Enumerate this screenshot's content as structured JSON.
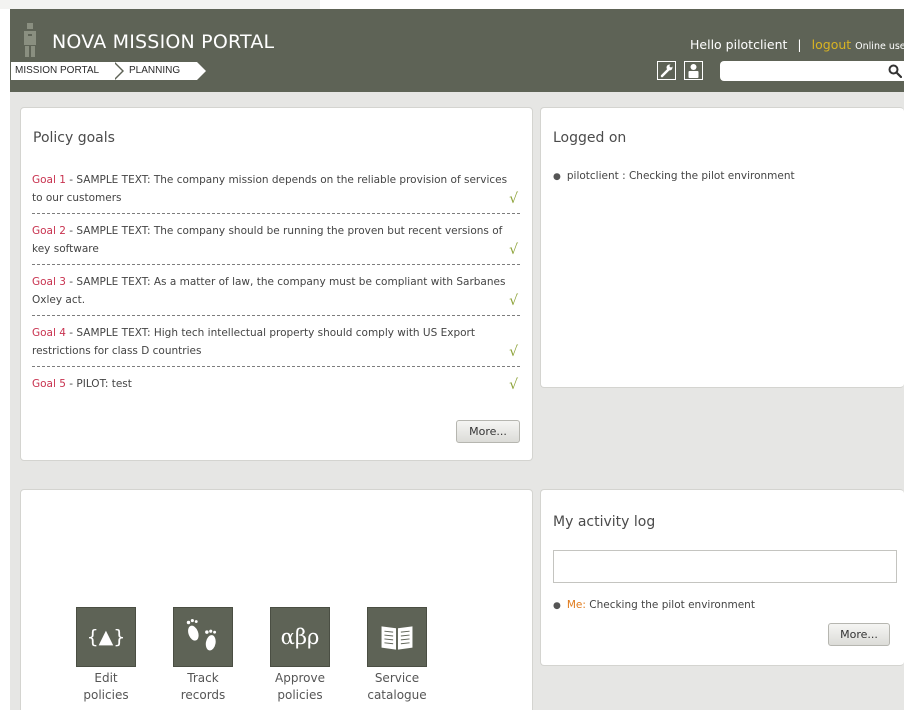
{
  "header": {
    "brand": "NOVA MISSION PORTAL",
    "greeting": "Hello pilotclient",
    "separator": "|",
    "logout": "logout",
    "online_users": "Online users:"
  },
  "breadcrumb": [
    "MISSION PORTAL",
    "PLANNING"
  ],
  "search": {
    "placeholder": ""
  },
  "policy": {
    "title": "Policy goals",
    "goals": [
      {
        "label": "Goal 1",
        "text": " - SAMPLE TEXT: The company mission depends on the reliable provision of services to our customers",
        "status": "√"
      },
      {
        "label": "Goal 2",
        "text": " - SAMPLE TEXT: The company should be running the proven but recent versions of key software",
        "status": "√"
      },
      {
        "label": "Goal 3",
        "text": " - SAMPLE TEXT: As a matter of law, the company must be compliant with Sarbanes Oxley act.",
        "status": "√"
      },
      {
        "label": "Goal 4",
        "text": " - SAMPLE TEXT: High tech intellectual property should comply with US Export restrictions for class D countries",
        "status": "√"
      },
      {
        "label": "Goal 5",
        "text": " - PILOT: test",
        "status": "√"
      }
    ],
    "more": "More..."
  },
  "logged_on": {
    "title": "Logged on",
    "entries": [
      "pilotclient : Checking the pilot environment"
    ]
  },
  "apps": [
    {
      "icon": "edit-policies-icon",
      "glyph": "{▲}",
      "label_1": "Edit",
      "label_2": "policies"
    },
    {
      "icon": "footprints-icon",
      "glyph": "",
      "label_1": "Track",
      "label_2": "records"
    },
    {
      "icon": "greek-letters-icon",
      "glyph": "αβρ",
      "label_1": "Approve",
      "label_2": "policies"
    },
    {
      "icon": "book-icon",
      "glyph": "",
      "label_1": "Service",
      "label_2": "catalogue"
    }
  ],
  "activity": {
    "title": "My activity log",
    "input_value": "",
    "entries": [
      {
        "who": "Me:",
        "text": " Checking the pilot environment"
      }
    ],
    "more": "More..."
  },
  "colors": {
    "header_bg": "#5e6356",
    "goal_label": "#c8324f",
    "check": "#8ea33a",
    "logout": "#d9b422",
    "me": "#e07a1b"
  }
}
